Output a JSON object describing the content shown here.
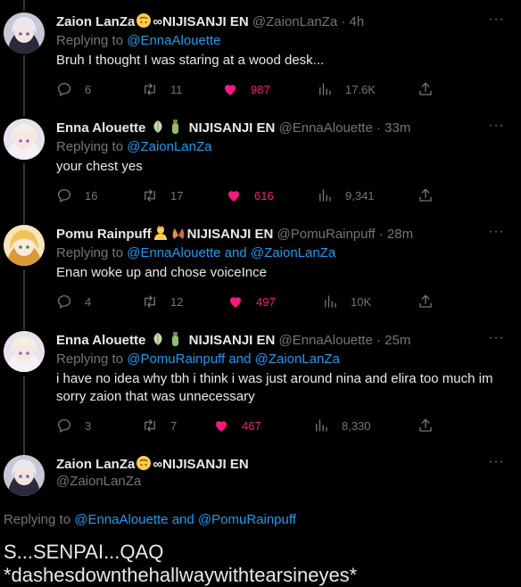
{
  "tweets": [
    {
      "name": "Zaion LanZa",
      "name_suffix": "∞NIJISANJI EN",
      "handle": "@ZaionLanZa",
      "time": "4h",
      "replying_prefix": "Replying to",
      "replying_to": [
        "@EnnaAlouette"
      ],
      "replying_joiner": "",
      "text": "Bruh I thought I was staring at a wood desk...",
      "replies": "6",
      "retweets": "11",
      "likes": "987",
      "views": "17.6K"
    },
    {
      "name": "Enna Alouette",
      "name_suffix": "NIJISANJI EN",
      "handle": "@EnnaAlouette",
      "time": "33m",
      "replying_prefix": "Replying to",
      "replying_to": [
        "@ZaionLanZa"
      ],
      "replying_joiner": "",
      "text": "your chest yes",
      "replies": "16",
      "retweets": "17",
      "likes": "616",
      "views": "9,341"
    },
    {
      "name": "Pomu Rainpuff",
      "name_suffix": "NIJISANJI EN",
      "handle": "@PomuRainpuff",
      "time": "28m",
      "replying_prefix": "Replying to",
      "replying_to": [
        "@EnnaAlouette",
        "@ZaionLanZa"
      ],
      "replying_joiner": "and",
      "text": "Enan woke up and chose voiceInce",
      "replies": "4",
      "retweets": "12",
      "likes": "497",
      "views": "10K"
    },
    {
      "name": "Enna Alouette",
      "name_suffix": "NIJISANJI EN",
      "handle": "@EnnaAlouette",
      "time": "25m",
      "replying_prefix": "Replying to",
      "replying_to": [
        "@PomuRainpuff",
        "@ZaionLanZa"
      ],
      "replying_joiner": "and",
      "text_lines": [
        "i have no idea why tbh i think i was just around nina and elira too much im",
        "sorry zaion that was unnecessary"
      ],
      "replies": "3",
      "retweets": "7",
      "likes": "467",
      "views": "8,330"
    }
  ],
  "main": {
    "name": "Zaion LanZa",
    "name_suffix": "∞NIJISANJI EN",
    "handle": "@ZaionLanZa",
    "replying_prefix": "Replying to",
    "replying_a": "@EnnaAlouette",
    "replying_joiner": "and",
    "replying_b": "@PomuRainpuff",
    "line1": "S...SENPAI...QAQ",
    "line2": "*dashesdownthehallwaywithtearsineyes*"
  },
  "more_label": "···",
  "sep": "·",
  "colors": {
    "like": "#f91880",
    "link": "#1d9bf0",
    "muted": "#71767b",
    "text": "#e7e9ea",
    "bg": "#000000"
  },
  "icons": [
    "reply-icon",
    "retweet-icon",
    "like-icon",
    "views-icon",
    "share-icon",
    "more-icon"
  ]
}
